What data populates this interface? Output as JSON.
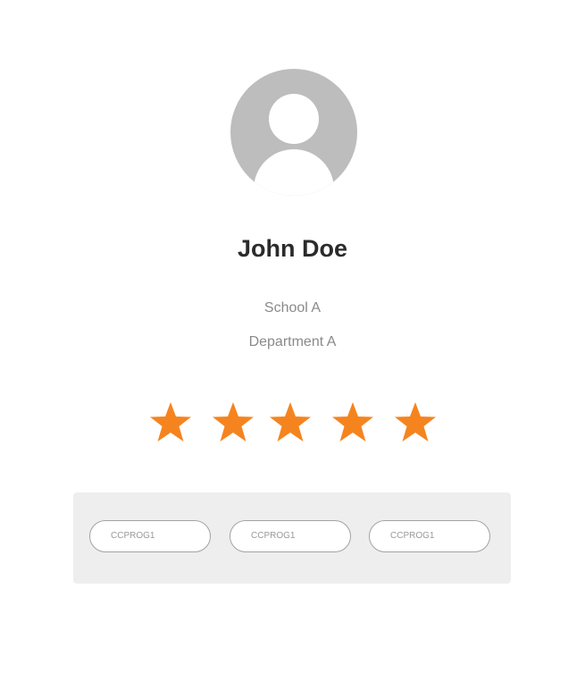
{
  "profile": {
    "avatar_icon": "user-avatar-icon",
    "name": "John Doe",
    "school": "School A",
    "department": "Department A"
  },
  "rating": {
    "value": 5,
    "max": 5,
    "star_icon": "star-icon",
    "star_color": "#F5841F"
  },
  "courses": [
    {
      "label": "CCPROG1"
    },
    {
      "label": "CCPROG1"
    },
    {
      "label": "CCPROG1"
    }
  ]
}
